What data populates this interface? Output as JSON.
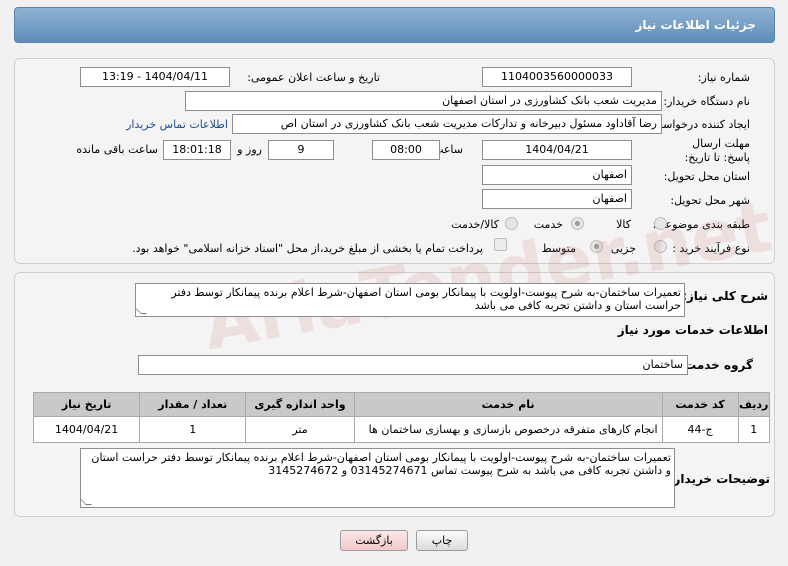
{
  "header": {
    "title": "جزئیات اطلاعات نیاز"
  },
  "form": {
    "need_number_label": "شماره نیاز:",
    "need_number": "1104003560000033",
    "announce_label": "تاریخ و ساعت اعلان عمومی:",
    "announce_value": "1404/04/11 - 13:19",
    "buyer_org_label": "نام دستگاه خریدار:",
    "buyer_org": "مدیریت شعب بانک کشاورزی در استان اصفهان",
    "requester_label": "ایجاد کننده درخواست:",
    "requester": "رضا آقاداود مسئول دبیرخانه و تدارکات مدیریت شعب بانک کشاورزی در استان اص",
    "contact_link": "اطلاعات تماس خریدار",
    "deadline_label": "مهلت ارسال پاسخ: تا تاریخ:",
    "deadline_date": "1404/04/21",
    "time_label": "ساعت",
    "deadline_time": "08:00",
    "days": "9",
    "days_label": "روز و",
    "remaining_time": "18:01:18",
    "remaining_label": "ساعت باقی مانده",
    "province_label": "استان محل تحویل:",
    "province": "اصفهان",
    "city_label": "شهر محل تحویل:",
    "city": "اصفهان",
    "category_label": "طبقه بندی موضوعی:",
    "category_options": [
      "کالا",
      "خدمت",
      "کالا/خدمت"
    ],
    "category_selected": "خدمت",
    "process_label": "نوع فرآیند خرید :",
    "process_options": [
      "جزیی",
      "متوسط"
    ],
    "process_selected": "متوسط",
    "treasury_note": "پرداخت تمام یا بخشی از مبلغ خرید،از محل \"اسناد خزانه اسلامی\" خواهد بود."
  },
  "description": {
    "label": "شرح کلی نیاز:",
    "text": "تعمیرات ساختمان-به شرح پیوست-اولویت با پیمانکار بومی استان اصفهان-شرط اعلام برنده پیمانکار توسط دفتر حراست استان و داشتن تجربه کافی می باشد"
  },
  "services": {
    "section_title": "اطلاعات خدمات مورد نیاز",
    "group_label": "گروه خدمت:",
    "group_value": "ساختمان",
    "columns": [
      "ردیف",
      "کد خدمت",
      "نام خدمت",
      "واحد اندازه گیری",
      "تعداد / مقدار",
      "تاریخ نیاز"
    ],
    "rows": [
      {
        "row": "1",
        "code": "ج-44",
        "name": "انجام کارهای متفرقه درخصوص بازسازی و بهسازی ساختمان ها",
        "unit": "متر",
        "qty": "1",
        "date": "1404/04/21"
      }
    ]
  },
  "buyer_notes": {
    "label": "توضیحات خریدار:",
    "text": "تعمیرات ساختمان-به شرح پیوست-اولویت با پیمانکار بومی استان اصفهان-شرط اعلام برنده پیمانکار توسط دفتر حراست استان و داشتن تجربه کافی می باشد به شرح پیوست تماس 03145274671 و 3145274672"
  },
  "buttons": {
    "print": "چاپ",
    "back": "بازگشت"
  },
  "watermark": "AriaTender.net"
}
